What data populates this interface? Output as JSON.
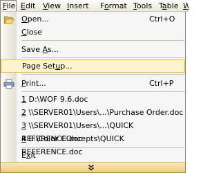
{
  "menubar": {
    "items": [
      {
        "label": "File",
        "underline": "F"
      },
      {
        "label": "Edit",
        "underline": "E"
      },
      {
        "label": "View",
        "underline": "V"
      },
      {
        "label": "Insert",
        "underline": "I"
      },
      {
        "label": "Format",
        "underline": "o"
      },
      {
        "label": "Tools",
        "underline": "T"
      },
      {
        "label": "Table",
        "underline": "a"
      },
      {
        "label": "W",
        "underline": "W"
      }
    ]
  },
  "file_menu": {
    "open": {
      "pre": "",
      "key": "O",
      "post": "pen...",
      "shortcut": "Ctrl+O",
      "icon": "folder-open-icon"
    },
    "close": {
      "pre": "",
      "key": "C",
      "post": "lose"
    },
    "save_as": {
      "pre": "Save ",
      "key": "A",
      "post": "s..."
    },
    "page_setup": {
      "pre": "Page Set",
      "key": "u",
      "post": "p..."
    },
    "print": {
      "pre": "",
      "key": "P",
      "post": "rint...",
      "shortcut": "Ctrl+P",
      "icon": "printer-icon"
    },
    "recent": [
      {
        "key": "1",
        "text": " D:\\WOF 9.6.doc"
      },
      {
        "key": "2",
        "text": " \\\\SERVER01\\Users\\...\\Purchase Order.doc"
      },
      {
        "key": "3",
        "text": " \\\\SERVER01\\Users\\...\\QUICK REFERENCE.doc"
      },
      {
        "key": "4",
        "text": " E:\\Color COncepts\\QUICK REFERENCE.doc"
      }
    ],
    "exit": {
      "pre": "E",
      "key": "x",
      "post": "it"
    },
    "expand_icon": "double-chevron-down-icon"
  },
  "colors": {
    "highlight_bg": "#fdf3cf",
    "highlight_border": "#d9b96a",
    "footer": "#f1cd78"
  }
}
